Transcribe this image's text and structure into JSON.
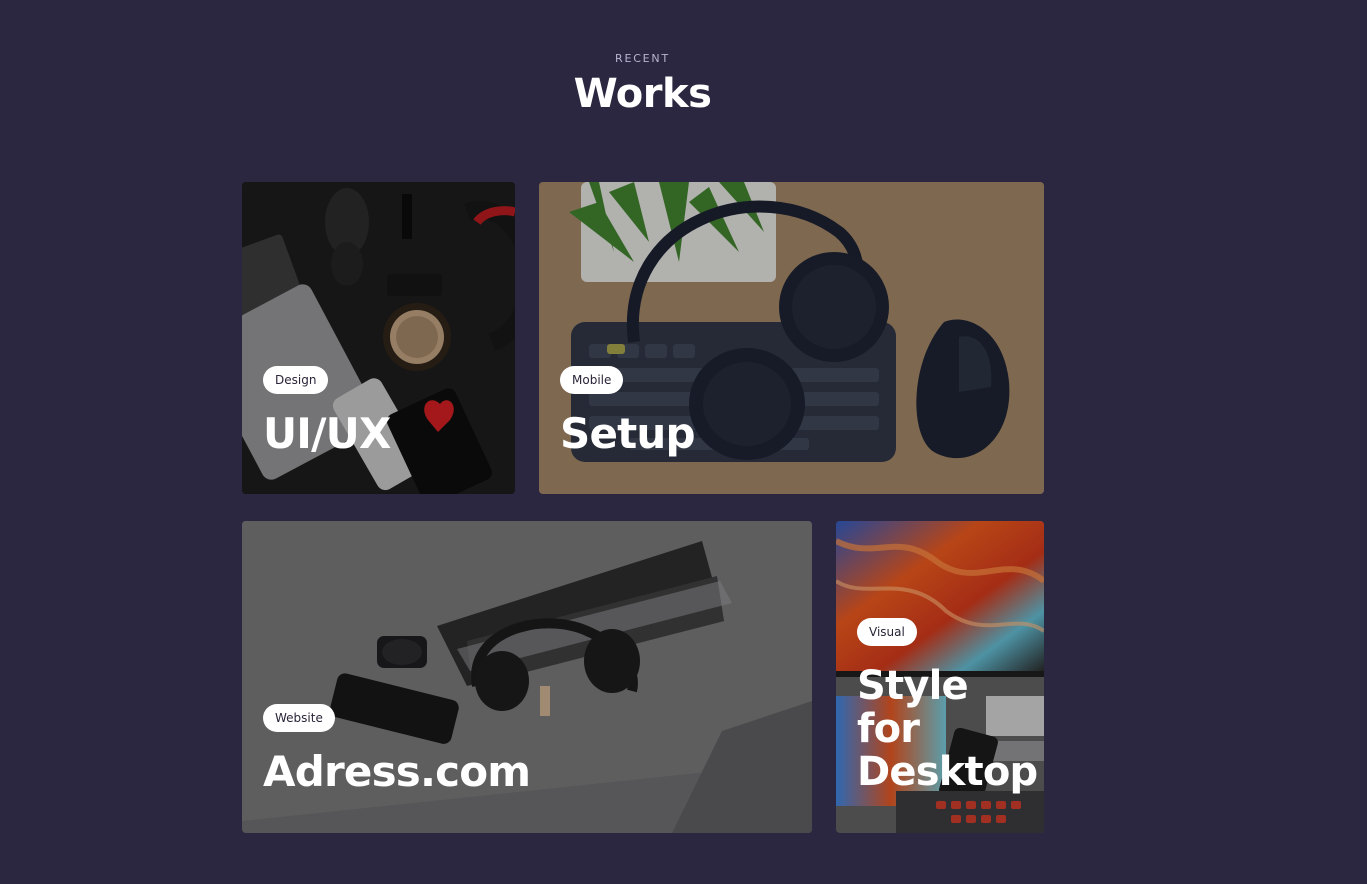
{
  "header": {
    "eyebrow": "RECENT",
    "title": "Works"
  },
  "works": [
    {
      "tag": "Design",
      "title": "UI/UX"
    },
    {
      "tag": "Mobile",
      "title": "Setup"
    },
    {
      "tag": "Website",
      "title": "Adress.com"
    },
    {
      "tag": "Visual",
      "title": "Style for Desktop"
    }
  ],
  "colors": {
    "background": "#2c2740",
    "tag_background": "#ffffff",
    "tag_text": "#2a2438",
    "heading": "#ffffff"
  }
}
